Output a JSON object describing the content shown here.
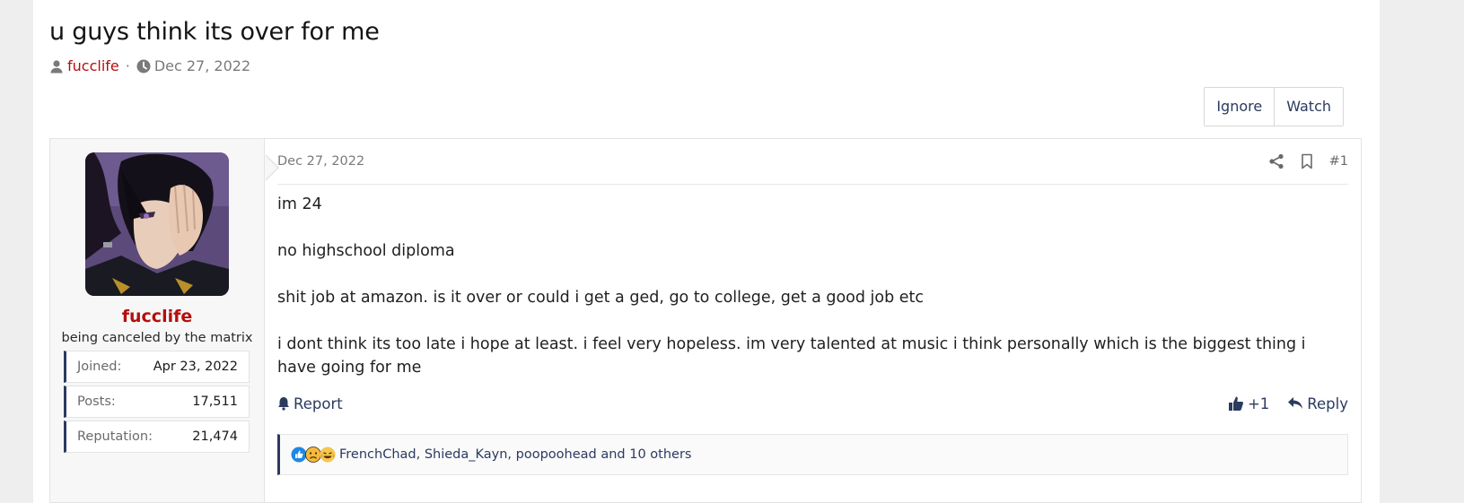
{
  "thread": {
    "title": "u guys think its over for me",
    "author": "fucclife",
    "separator": "·",
    "date": "Dec 27, 2022"
  },
  "actions": {
    "ignore": "Ignore",
    "watch": "Watch"
  },
  "user": {
    "name": "fucclife",
    "title": "being canceled by the matrix",
    "stats": [
      {
        "label": "Joined:",
        "value": "Apr 23, 2022"
      },
      {
        "label": "Posts:",
        "value": "17,511"
      },
      {
        "label": "Reputation:",
        "value": "21,474"
      }
    ]
  },
  "post": {
    "date": "Dec 27, 2022",
    "number": "#1",
    "paragraphs": [
      "im 24",
      "no highschool diploma",
      "shit job at amazon. is it over or could i get a ged, go to college, get a good job etc",
      "i dont think its too late i hope at least. i feel very hopeless. im very talented at music i think personally which is the biggest thing i have going for me"
    ],
    "report": "Report",
    "plus_one": "+1",
    "reply": "Reply",
    "reactions_text": "FrenchChad, Shieda_Kayn, poopoohead and 10 others"
  },
  "colors": {
    "accent": "#2b3a60",
    "username": "#b50e0e",
    "page_bg": "#eeeeee"
  }
}
